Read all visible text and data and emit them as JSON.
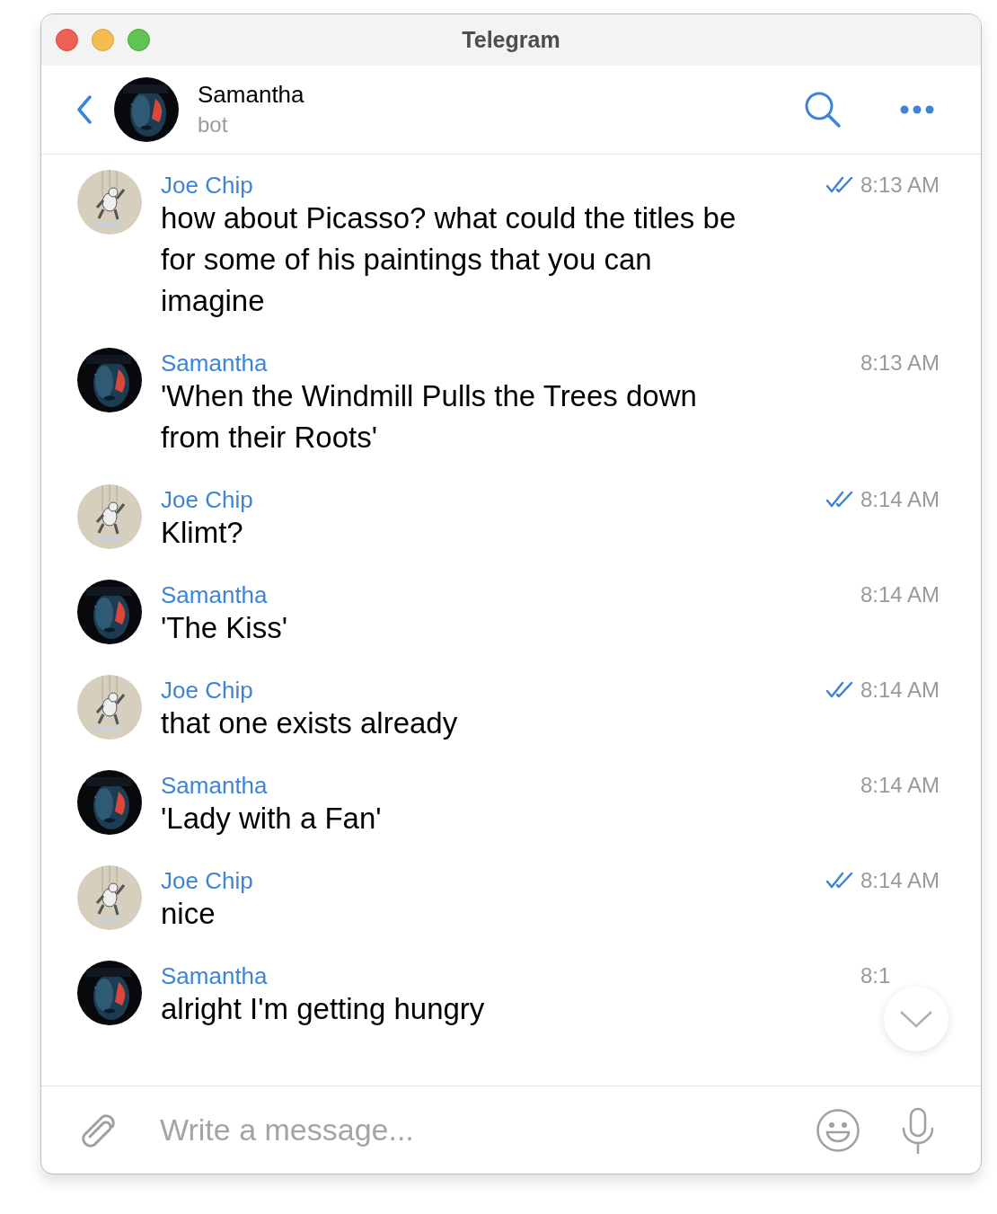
{
  "window": {
    "title": "Telegram"
  },
  "header": {
    "name": "Samantha",
    "status": "bot"
  },
  "messages": [
    {
      "sender": "Joe Chip",
      "text": "how about Picasso? what could the titles be for some of his paintings that you can imagine",
      "time": "8:13 AM",
      "read": true
    },
    {
      "sender": "Samantha",
      "text": "'When the Windmill Pulls the Trees down from their Roots'",
      "time": "8:13 AM",
      "read": false
    },
    {
      "sender": "Joe Chip",
      "text": "Klimt?",
      "time": "8:14 AM",
      "read": true
    },
    {
      "sender": "Samantha",
      "text": "'The Kiss'",
      "time": "8:14 AM",
      "read": false
    },
    {
      "sender": "Joe Chip",
      "text": "that one exists already",
      "time": "8:14 AM",
      "read": true
    },
    {
      "sender": "Samantha",
      "text": "'Lady with a Fan'",
      "time": "8:14 AM",
      "read": false
    },
    {
      "sender": "Joe Chip",
      "text": "nice",
      "time": "8:14 AM",
      "read": true
    },
    {
      "sender": "Samantha",
      "text": "alright I'm getting hungry",
      "time": "8:1",
      "read": false
    }
  ],
  "composer": {
    "placeholder": "Write a message..."
  }
}
